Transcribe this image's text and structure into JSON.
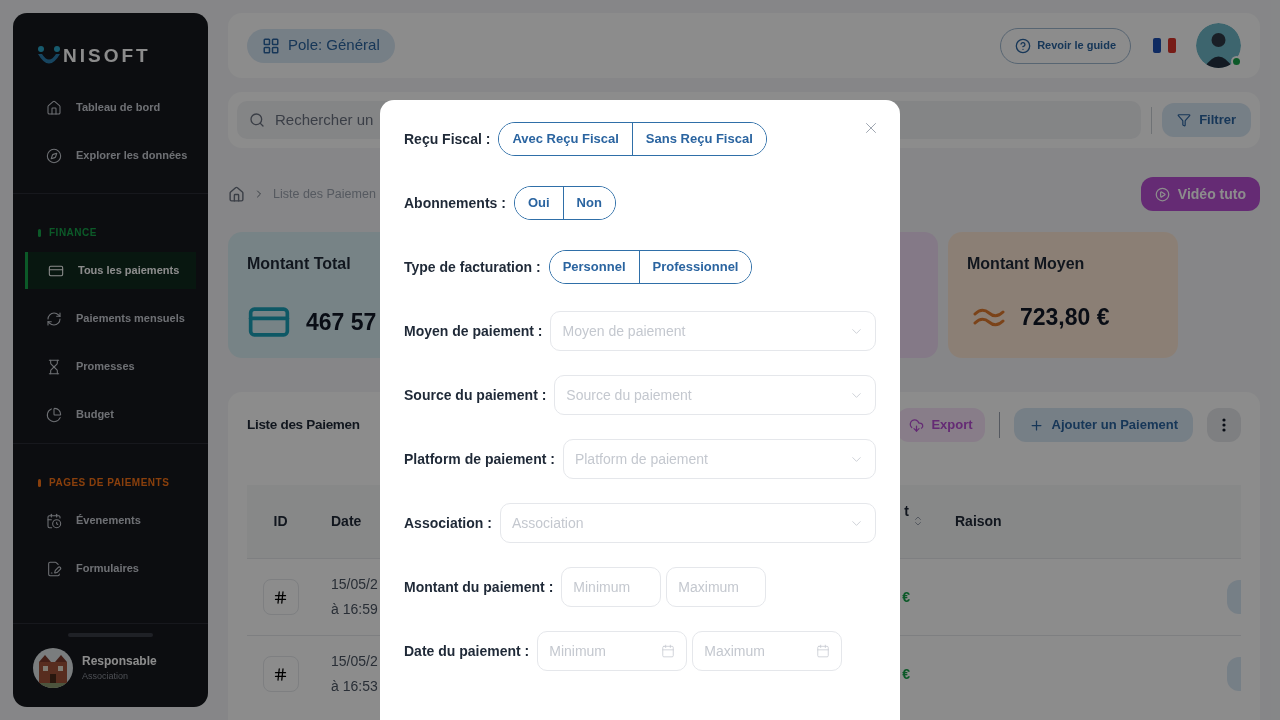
{
  "sidebar": {
    "logo": "NISOFT",
    "items": [
      {
        "label": "Tableau de bord",
        "selected": false
      },
      {
        "label": "Explorer les données",
        "selected": false
      }
    ],
    "sections": [
      {
        "heading": "FINANCE",
        "items": [
          {
            "label": "Tous les paiements",
            "selected": true
          },
          {
            "label": "Paiements mensuels",
            "selected": false
          },
          {
            "label": "Promesses",
            "selected": false
          },
          {
            "label": "Budget",
            "selected": false
          }
        ]
      },
      {
        "heading": "PAGES DE PAIEMENTS",
        "items": [
          {
            "label": "Évenements",
            "selected": false
          },
          {
            "label": "Formulaires",
            "selected": false
          }
        ]
      }
    ],
    "user": {
      "name": "Responsable",
      "role": "Association"
    }
  },
  "topbar": {
    "pole_button": "Pole: Général",
    "guide_button": "Revoir le guide",
    "avatar": {
      "online": true
    }
  },
  "search": {
    "placeholder": "Rechercher un"
  },
  "filter_button": "Filtrer",
  "breadcrumb": [
    "Liste des Paiemen"
  ],
  "video_button": "Vidéo tuto",
  "stats": [
    {
      "kind": "total",
      "title": "Montant Total",
      "value": "467 57"
    },
    {
      "kind": "blank"
    },
    {
      "kind": "average",
      "title": "Montant Moyen",
      "value": "723,80 €"
    }
  ],
  "list": {
    "title": "Liste des Paiemen",
    "export_button": "Export",
    "add_button": "Ajouter un Paiement",
    "columns": [
      "ID",
      "Date",
      "t",
      "Raison"
    ],
    "rows": [
      {
        "date": "15/05/2",
        "time": "à 16:59",
        "amount": "€"
      },
      {
        "date": "15/05/2",
        "time": "à 16:53",
        "amount": "€"
      }
    ]
  },
  "modal": {
    "filters": [
      {
        "kind": "segmented",
        "label": "Reçu Fiscal :",
        "options": [
          {
            "label": "Avec Reçu Fiscal",
            "selected": false
          },
          {
            "label": "Sans Reçu Fiscal",
            "selected": false
          }
        ]
      },
      {
        "kind": "segmented",
        "label": "Abonnements :",
        "options": [
          {
            "label": "Oui",
            "selected": false
          },
          {
            "label": "Non",
            "selected": false
          }
        ]
      },
      {
        "kind": "segmented",
        "label": "Type de facturation :",
        "options": [
          {
            "label": "Personnel",
            "selected": false
          },
          {
            "label": "Professionnel",
            "selected": false
          }
        ]
      },
      {
        "kind": "select",
        "label": "Moyen de paiement :",
        "placeholder": "Moyen de paiement"
      },
      {
        "kind": "select",
        "label": "Source du paiement :",
        "placeholder": "Source du paiement"
      },
      {
        "kind": "select",
        "label": "Platform de paiement :",
        "placeholder": "Platform de paiement"
      },
      {
        "kind": "select",
        "label": "Association :",
        "placeholder": "Association"
      },
      {
        "kind": "range",
        "label": "Montant du paiement :",
        "placeholders": [
          "Minimum",
          "Maximum"
        ]
      },
      {
        "kind": "date_range",
        "label": "Date du paiement :",
        "placeholders": [
          "Minimum",
          "Maximum"
        ]
      }
    ]
  }
}
